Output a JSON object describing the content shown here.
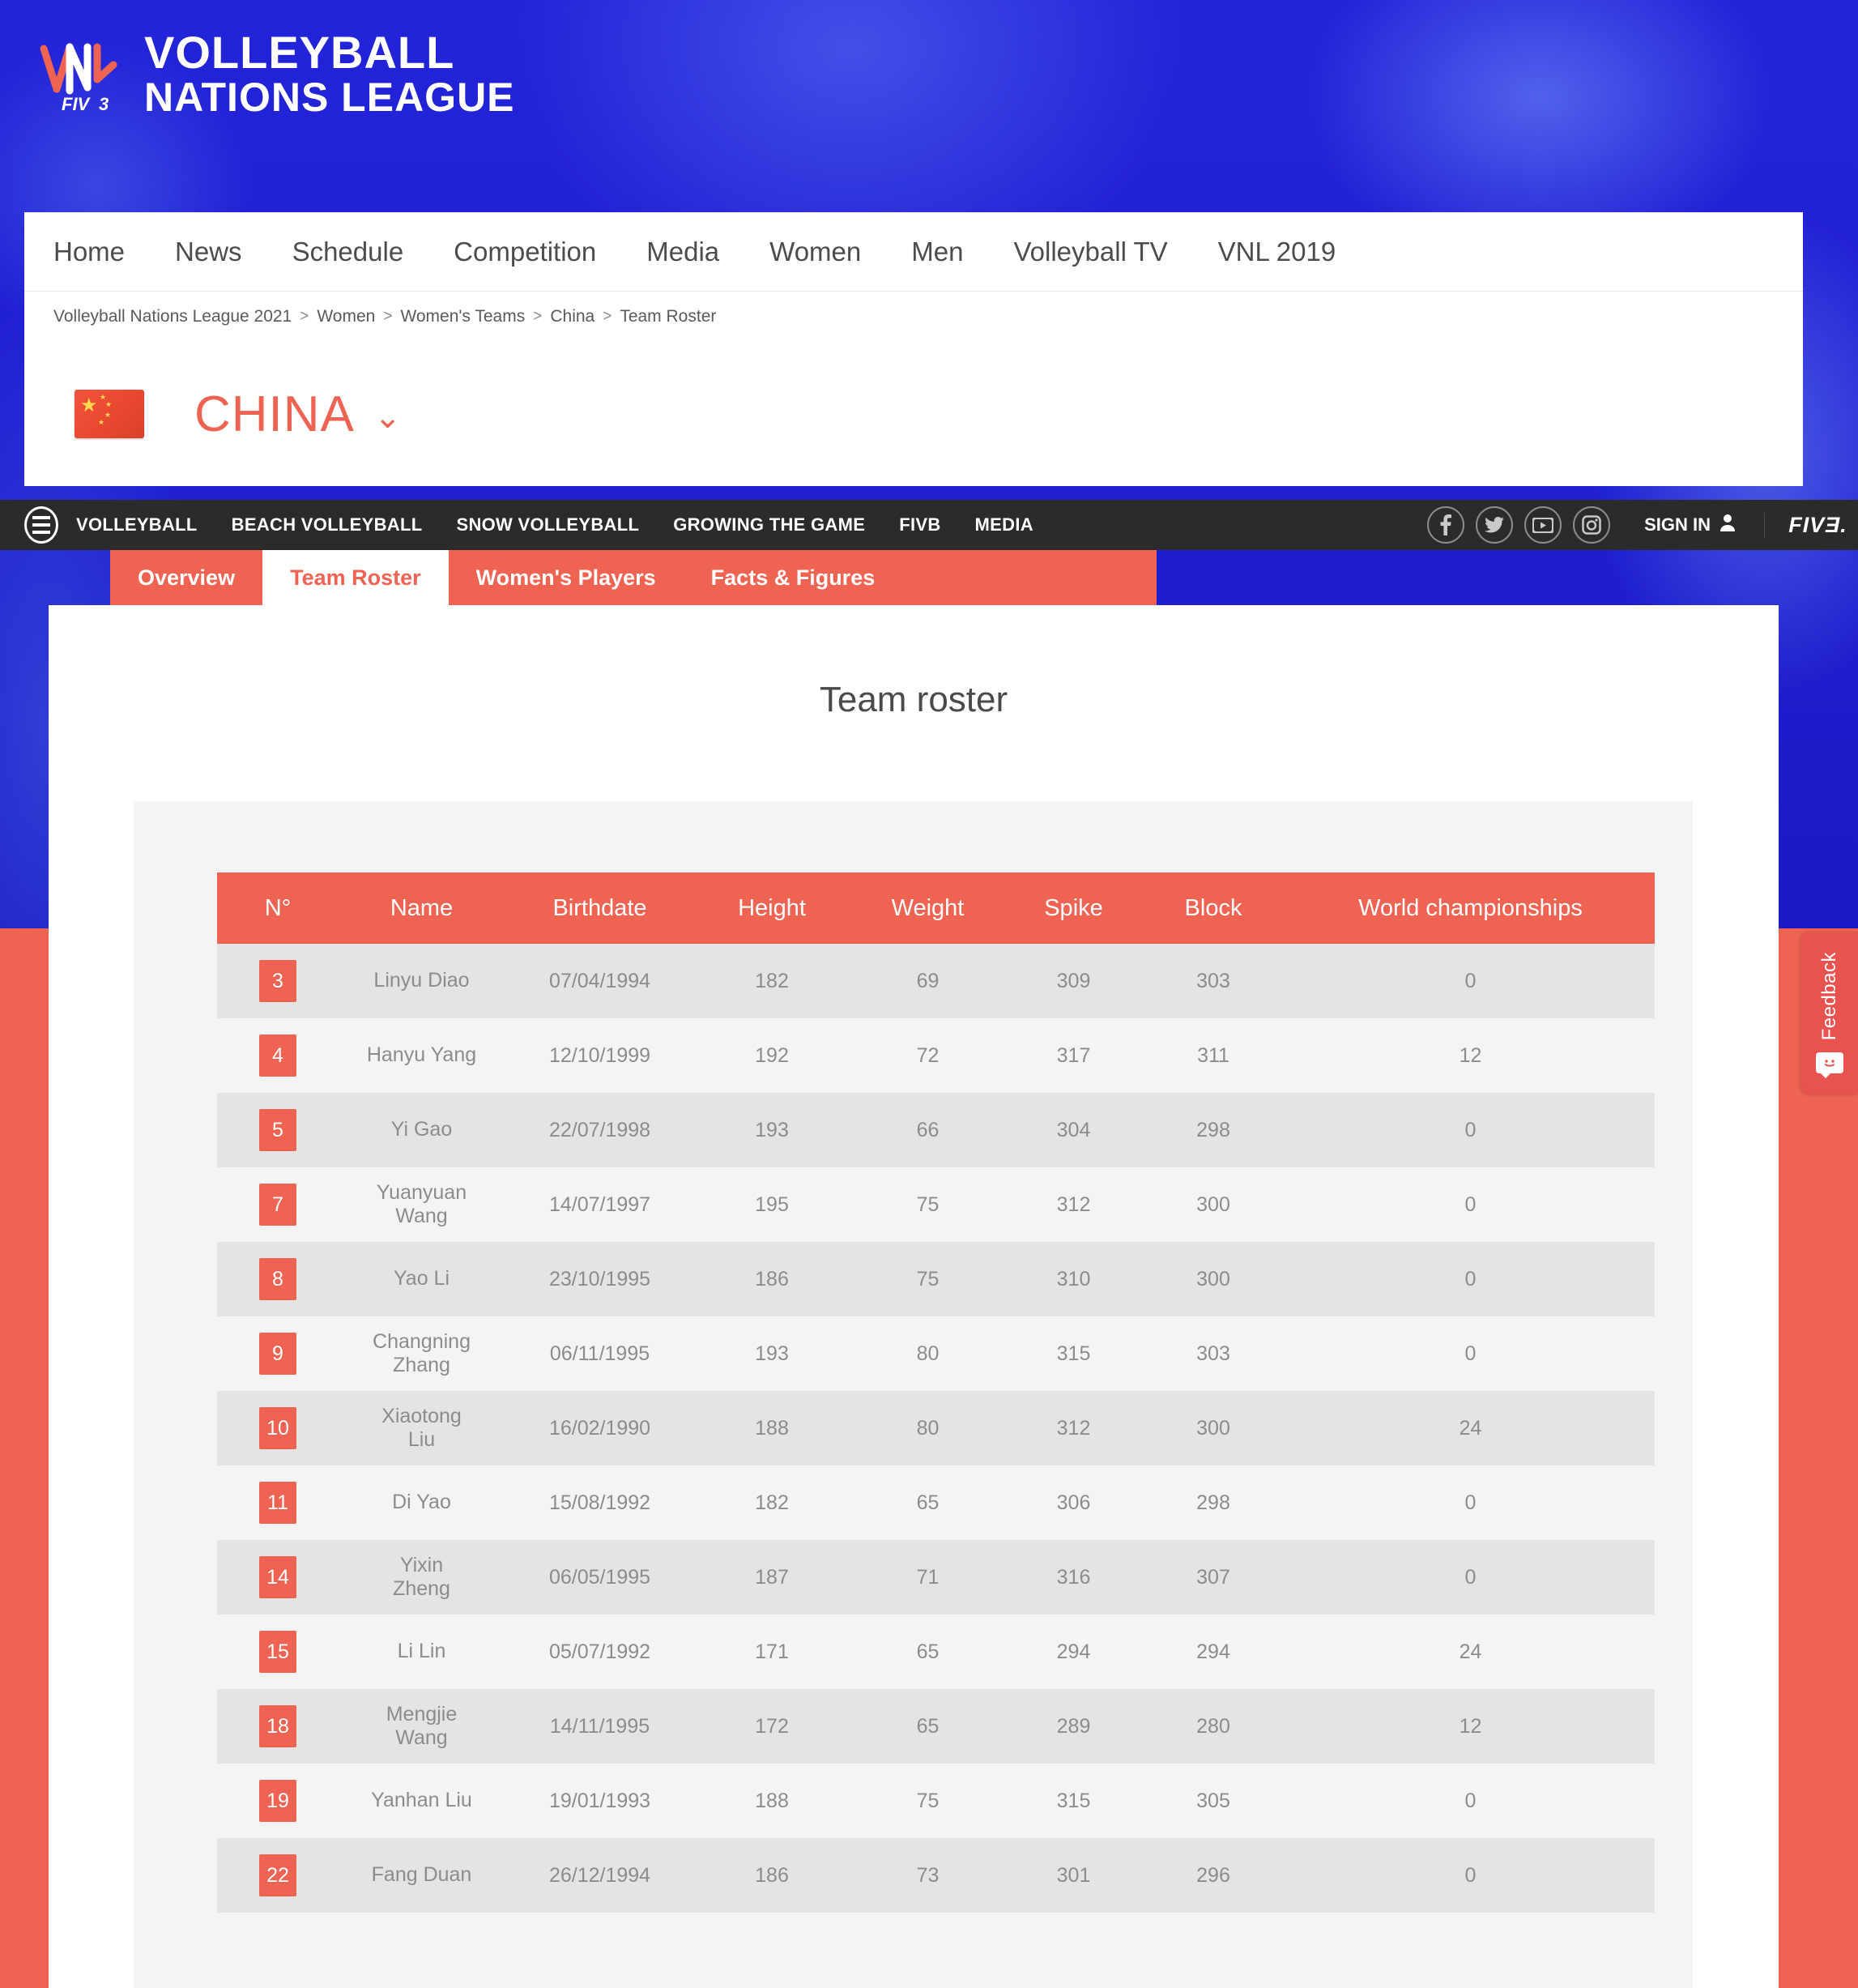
{
  "brand": {
    "logo_mark": "VNL",
    "logo_sub": "FIVB",
    "title_line1": "VOLLEYBALL",
    "title_line2": "NATIONS LEAGUE",
    "accent_color": "#ee6352",
    "hero_color": "#2121d4"
  },
  "mainnav": {
    "items": [
      {
        "label": "Home"
      },
      {
        "label": "News"
      },
      {
        "label": "Schedule"
      },
      {
        "label": "Competition"
      },
      {
        "label": "Media"
      },
      {
        "label": "Women"
      },
      {
        "label": "Men"
      },
      {
        "label": "Volleyball TV"
      },
      {
        "label": "VNL 2019"
      }
    ]
  },
  "breadcrumb": {
    "separator": ">",
    "items": [
      {
        "label": "Volleyball Nations League 2021"
      },
      {
        "label": "Women"
      },
      {
        "label": "Women's Teams"
      },
      {
        "label": "China"
      },
      {
        "label": "Team Roster"
      }
    ]
  },
  "team_header": {
    "name": "CHINA",
    "flag_alt": "china-flag",
    "dropdown_icon": "chevron-down-icon"
  },
  "fivbbar": {
    "menu_icon": "hamburger-icon",
    "links": [
      {
        "label": "VOLLEYBALL"
      },
      {
        "label": "BEACH VOLLEYBALL"
      },
      {
        "label": "SNOW VOLLEYBALL"
      },
      {
        "label": "GROWING THE GAME"
      },
      {
        "label": "FIVB"
      },
      {
        "label": "MEDIA"
      }
    ],
    "social": [
      {
        "name": "facebook-icon",
        "glyph": "f"
      },
      {
        "name": "twitter-icon",
        "glyph": "ᴠ"
      },
      {
        "name": "youtube-icon",
        "glyph": "▶"
      },
      {
        "name": "instagram-icon",
        "glyph": "□"
      }
    ],
    "signin_label": "SIGN IN",
    "signin_icon": "user-icon",
    "logo": "FIVƎ."
  },
  "tabs": [
    {
      "label": "Overview",
      "active": false
    },
    {
      "label": "Team Roster",
      "active": true
    },
    {
      "label": "Women's Players",
      "active": false
    },
    {
      "label": "Facts & Figures",
      "active": false
    }
  ],
  "page": {
    "title": "Team roster"
  },
  "roster": {
    "columns": [
      "N°",
      "Name",
      "Birthdate",
      "Height",
      "Weight",
      "Spike",
      "Block",
      "World championships"
    ],
    "rows": [
      {
        "no": "3",
        "name": "Linyu Diao",
        "birthdate": "07/04/1994",
        "height": "182",
        "weight": "69",
        "spike": "309",
        "block": "303",
        "wc": "0"
      },
      {
        "no": "4",
        "name": "Hanyu Yang",
        "birthdate": "12/10/1999",
        "height": "192",
        "weight": "72",
        "spike": "317",
        "block": "311",
        "wc": "12"
      },
      {
        "no": "5",
        "name": "Yi Gao",
        "birthdate": "22/07/1998",
        "height": "193",
        "weight": "66",
        "spike": "304",
        "block": "298",
        "wc": "0"
      },
      {
        "no": "7",
        "name": "Yuanyuan Wang",
        "birthdate": "14/07/1997",
        "height": "195",
        "weight": "75",
        "spike": "312",
        "block": "300",
        "wc": "0"
      },
      {
        "no": "8",
        "name": "Yao Li",
        "birthdate": "23/10/1995",
        "height": "186",
        "weight": "75",
        "spike": "310",
        "block": "300",
        "wc": "0"
      },
      {
        "no": "9",
        "name": "Changning Zhang",
        "birthdate": "06/11/1995",
        "height": "193",
        "weight": "80",
        "spike": "315",
        "block": "303",
        "wc": "0"
      },
      {
        "no": "10",
        "name": "Xiaotong Liu",
        "birthdate": "16/02/1990",
        "height": "188",
        "weight": "80",
        "spike": "312",
        "block": "300",
        "wc": "24"
      },
      {
        "no": "11",
        "name": "Di Yao",
        "birthdate": "15/08/1992",
        "height": "182",
        "weight": "65",
        "spike": "306",
        "block": "298",
        "wc": "0"
      },
      {
        "no": "14",
        "name": "Yixin Zheng",
        "birthdate": "06/05/1995",
        "height": "187",
        "weight": "71",
        "spike": "316",
        "block": "307",
        "wc": "0"
      },
      {
        "no": "15",
        "name": "Li Lin",
        "birthdate": "05/07/1992",
        "height": "171",
        "weight": "65",
        "spike": "294",
        "block": "294",
        "wc": "24"
      },
      {
        "no": "18",
        "name": "Mengjie Wang",
        "birthdate": "14/11/1995",
        "height": "172",
        "weight": "65",
        "spike": "289",
        "block": "280",
        "wc": "12"
      },
      {
        "no": "19",
        "name": "Yanhan Liu",
        "birthdate": "19/01/1993",
        "height": "188",
        "weight": "75",
        "spike": "315",
        "block": "305",
        "wc": "0"
      },
      {
        "no": "22",
        "name": "Fang Duan",
        "birthdate": "26/12/1994",
        "height": "186",
        "weight": "73",
        "spike": "301",
        "block": "296",
        "wc": "0"
      }
    ]
  },
  "feedback": {
    "label": "Feedback",
    "icon": "smiley-chat-icon",
    "icon_glyph": "◔◕"
  }
}
